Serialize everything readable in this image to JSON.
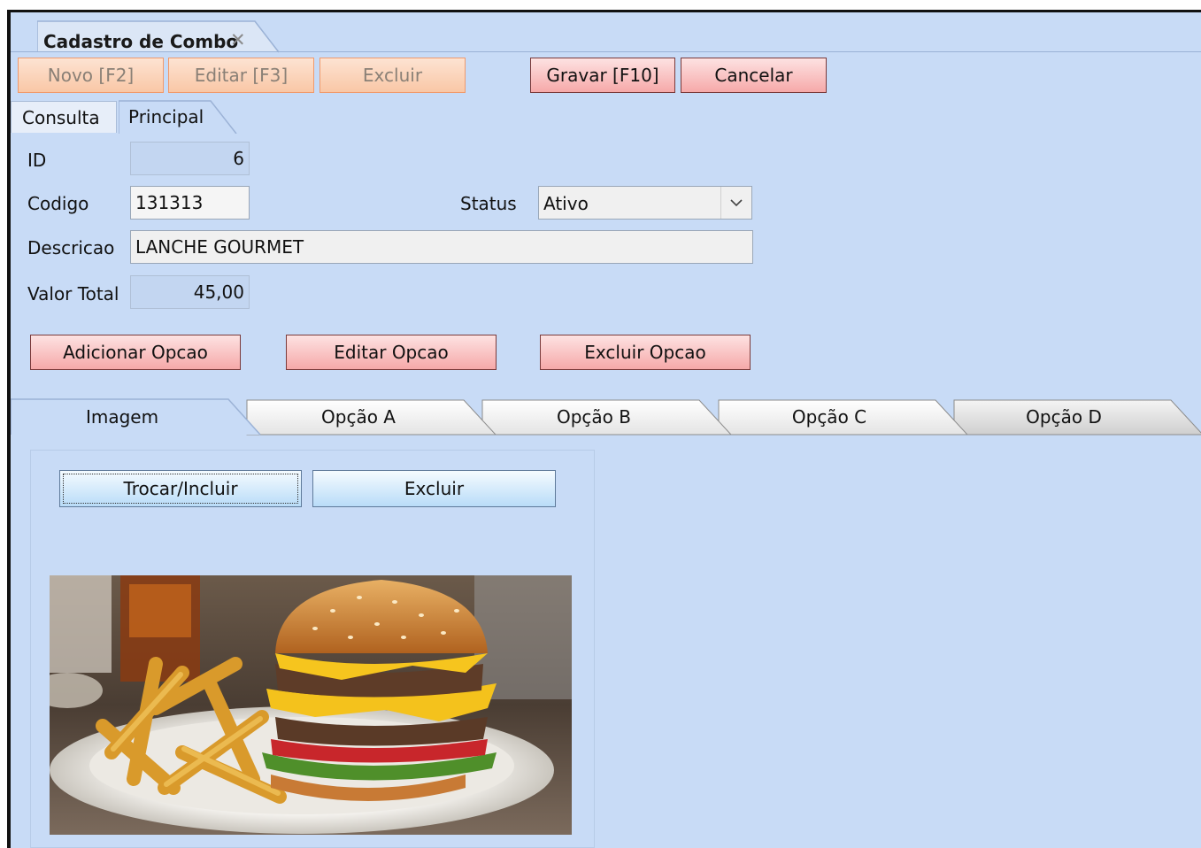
{
  "document_tab": {
    "label": "Cadastro de Combo",
    "close_symbol": "✕"
  },
  "toolbar": {
    "novo": "Novo [F2]",
    "editar": "Editar [F3]",
    "excluir": "Excluir",
    "gravar": "Gravar [F10]",
    "cancelar": "Cancelar"
  },
  "subtabs": {
    "consulta": "Consulta",
    "principal": "Principal",
    "selected": "Principal"
  },
  "form": {
    "id_label": "ID",
    "id_value": "6",
    "codigo_label": "Codigo",
    "codigo_value": "131313",
    "status_label": "Status",
    "status_value": "Ativo",
    "descricao_label": "Descricao",
    "descricao_value": "LANCHE GOURMET",
    "valor_total_label": "Valor Total",
    "valor_total_value": "45,00"
  },
  "option_buttons": {
    "adicionar": "Adicionar Opcao",
    "editar": "Editar Opcao",
    "excluir": "Excluir Opcao"
  },
  "lower_tabs": {
    "imagem": "Imagem",
    "opcao_a": "Opção A",
    "opcao_b": "Opção B",
    "opcao_c": "Opção C",
    "opcao_d": "Opção D",
    "selected": "Imagem"
  },
  "image_panel": {
    "trocar": "Trocar/Incluir",
    "excluir": "Excluir",
    "photo": "burger-and-fries-photo"
  },
  "colors": {
    "window_bg": "#c8dbf6",
    "action_button": "#f6a9a9",
    "disabled_button": "#f9c7a6",
    "blue_button": "#b9dcf8"
  }
}
